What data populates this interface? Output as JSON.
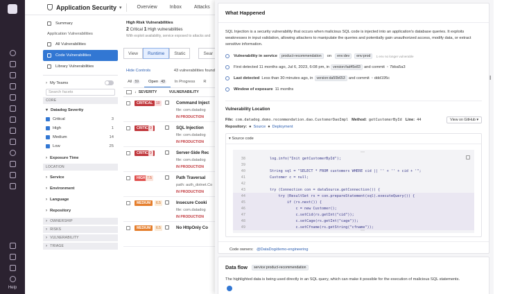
{
  "topbar": {
    "app_title": "Application Security",
    "nav": [
      "Overview",
      "Inbox",
      "Attacks"
    ]
  },
  "rail": {
    "help_label": "Help"
  },
  "facets": {
    "summary": "Summary",
    "section_label": "Application Vulnerabilities",
    "all_vulns": "All Vulnerabilities",
    "code_vulns": "Code Vulnerabilities",
    "library_vulns": "Library Vulnerabilities",
    "my_teams": "My Teams",
    "search_placeholder": "Search facets",
    "core_label": "CORE",
    "severity_label": "Datadog Severity",
    "severities": [
      {
        "label": "Critical",
        "count": "3"
      },
      {
        "label": "High",
        "count": "1"
      },
      {
        "label": "Medium",
        "count": "14"
      },
      {
        "label": "Low",
        "count": "25"
      }
    ],
    "exposure_time": "Exposure Time",
    "location_label": "LOCATION",
    "location_items": [
      "Service",
      "Environment",
      "Language",
      "Repository"
    ],
    "collapsed_sections": [
      "OWNERSHIP",
      "RISKS",
      "VULNERABILITY",
      "TRIAGE"
    ]
  },
  "middle": {
    "kpi_title": "High Risk Vulnerabilities",
    "kpi_critical_num": "2",
    "kpi_critical_label": "Critical",
    "kpi_high_num": "1",
    "kpi_high_label": "High vulnerabilities",
    "kpi_sub": "With exploit availability, service exposed to attacks and",
    "view_label": "View",
    "runtime_label": "Runtime",
    "static_label": "Static",
    "search_label": "Sear",
    "hide_controls": "Hide Controls",
    "found_text": "43 vulnerabilities found",
    "tabs": [
      {
        "label": "All",
        "count": "59"
      },
      {
        "label": "Open",
        "count": "43"
      },
      {
        "label": "In Progress",
        "count": ""
      },
      {
        "label": "R",
        "count": ""
      }
    ],
    "col_severity": "SEVERITY",
    "col_vuln": "VULNERABILITY",
    "rows": [
      {
        "sev": "CRITICAL",
        "score": "10",
        "title": "Command Inject",
        "file": "file: com.datadog",
        "prod": "IN PRODUCTION"
      },
      {
        "sev": "CRITICAL",
        "score": "9",
        "title": "SQL Injection",
        "file": "file: com.datadog",
        "prod": "IN PRODUCTION"
      },
      {
        "sev": "CRITICAL",
        "score": "9",
        "title": "Server-Side Rec",
        "file": "file: com.datadog",
        "prod": "IN PRODUCTION"
      },
      {
        "sev": "HIGH",
        "score": "7.5",
        "title": "Path Traversal",
        "file": "path: auth_dotnet.Co",
        "prod": "IN PRODUCTION"
      },
      {
        "sev": "MEDIUM",
        "score": "6.5",
        "title": "Insecure Cooki",
        "file": "file: com.datadog",
        "prod": "IN PRODUCTION"
      },
      {
        "sev": "MEDIUM",
        "score": "6.5",
        "title": "No HttpOnly Co",
        "file": "",
        "prod": ""
      }
    ]
  },
  "panel": {
    "what_happened_title": "What Happened",
    "description": "SQL Injection is a security vulnerability that occurs when malicious SQL code is injected into an application's database queries. It exploits weaknesses in input validation, allowing attackers to manipulate the queries and potentially gain unauthorized access, modify data, or extract sensitive information.",
    "vuln_in_service_label": "Vulnerability in service",
    "service_name": "product-recommendation",
    "on_label": "on",
    "env_tags": [
      "env:dev",
      "env:prod"
    ],
    "env_note": "1 env no longer vulnerable",
    "first_detected": "First detected 11 months ago, Jul 6, 2023, 6:08 pm, in",
    "first_version": "version:fad45e83",
    "and_commit": "and commit",
    "first_commit": "7bba5a3",
    "last_detected": "Last detected",
    "last_detected_text": "Less than 30 minutes ago, in",
    "last_version": "version:da50b653",
    "last_commit": "ddd195c",
    "window_label": "Window of exposure",
    "window_value": "11 months",
    "location_title": "Vulnerability Location",
    "file_label": "File:",
    "file_value": "com.datadog.demo.recommendation.dao.CustomerDaoImpl",
    "method_label": "Method:",
    "method_value": "getCustomerById",
    "line_label": "Line:",
    "line_value": "44",
    "repository_label": "Repository:",
    "source_link": "Source",
    "deployment_link": "Deployment",
    "view_github": "View on GitHub",
    "source_code_label": "Source code",
    "code_lines": [
      {
        "n": "38",
        "t": "        log.info(\"Init getCustomerById\");"
      },
      {
        "n": "39",
        "t": ""
      },
      {
        "n": "40",
        "t": "        String sql = \"SELECT * FROM customers WHERE cid || '' + '' + cid + '\";"
      },
      {
        "n": "41",
        "t": "        Customer c = null;"
      },
      {
        "n": "42",
        "t": ""
      },
      {
        "n": "43",
        "t": "        try (Connection con = dataSource.getConnection()) {"
      },
      {
        "n": "44",
        "t": "            try (ResultSet rs = con.prepareStatement(sql).executeQuery()) {"
      },
      {
        "n": "45",
        "t": "                if (rs.next()) {"
      },
      {
        "n": "46",
        "t": "                    c = new Customer();"
      },
      {
        "n": "47",
        "t": "                    c.setCid(rs.getInt(\"cid\"));"
      },
      {
        "n": "48",
        "t": "                    c.setCage(rs.getInt(\"cage\"));"
      },
      {
        "n": "49",
        "t": "                    c.setCfname(rs.getString(\"cfname\"));"
      }
    ],
    "code_owners_label": "Code owners:",
    "code_owners_value": "@DataDog/demo-engineering",
    "dataflow_title": "Data flow",
    "dataflow_tag": "service:product-recommendation",
    "dataflow_desc": "The highlighted data is being used directly in an SQL query, which can make it possible for the execution of malicious SQL statements."
  }
}
